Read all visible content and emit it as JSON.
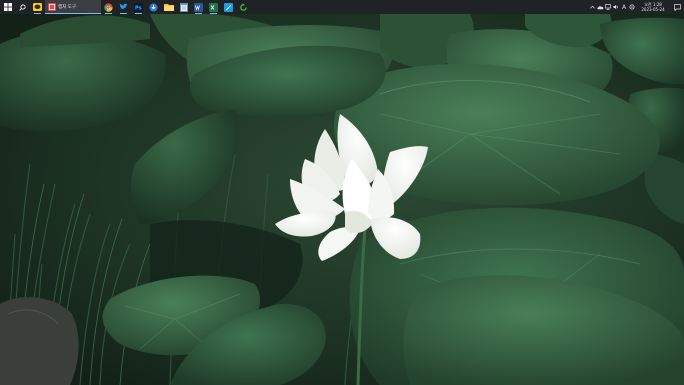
{
  "taskbar": {
    "start_icon": "windows-logo-icon",
    "search_icon": "search-icon",
    "pinned_apps": [
      {
        "name": "kakaotalk-icon",
        "color": "#f7d600"
      },
      {
        "name": "chrome-icon",
        "color": "#ea4335"
      },
      {
        "name": "twitter-icon",
        "color": "#1d9bf0"
      },
      {
        "name": "photoshop-icon",
        "color": "#0a1a33"
      },
      {
        "name": "store-icon",
        "color": "#2b7cd3"
      },
      {
        "name": "file-explorer-icon",
        "color": "#f2c14e"
      },
      {
        "name": "notepad-icon",
        "color": "#6b8fb5"
      },
      {
        "name": "word-icon",
        "color": "#2b579a"
      },
      {
        "name": "excel-icon",
        "color": "#217346"
      },
      {
        "name": "paint-icon",
        "color": "#1b9ce6"
      },
      {
        "name": "refresh-app-icon",
        "color": "#3fbf3f"
      }
    ],
    "active_task": {
      "label": "캡처 도구",
      "icon": "snipping-tool-icon",
      "accent": "#8ab4f8"
    },
    "tray": {
      "icons": [
        "chevron-up-icon",
        "cloud-icon",
        "network-icon",
        "volume-icon",
        "ime-indicator-icon",
        "settings-icon"
      ],
      "ime_label": "A",
      "time": "오전 1:28",
      "date": "2023-05-24",
      "notification_icon": "notification-icon"
    }
  },
  "wallpaper": {
    "subject": "white-lotus-flower",
    "colors": {
      "leaf_dark": "#1e3a27",
      "leaf_mid": "#2f5a3c",
      "leaf_light": "#3f7450",
      "petal": "#f4f6f2",
      "shadow": "#0f1c14"
    }
  }
}
